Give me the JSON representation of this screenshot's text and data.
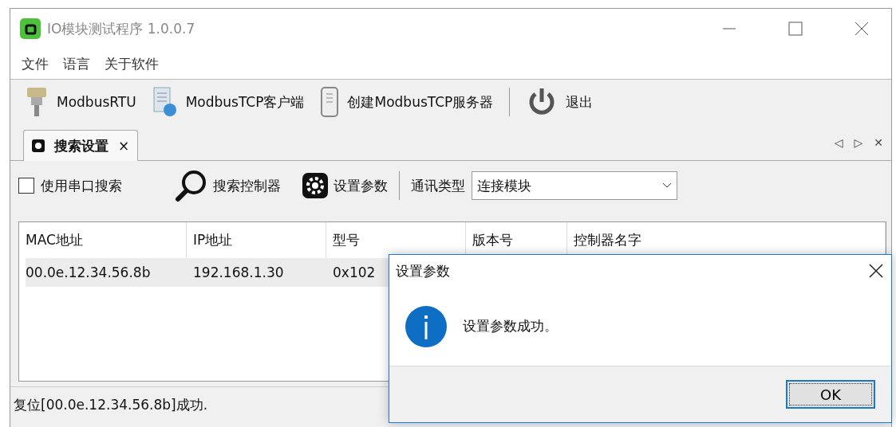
{
  "window": {
    "title": "IO模块测试程序 1.0.0.7"
  },
  "menu": [
    {
      "label": "文件"
    },
    {
      "label": "语言"
    },
    {
      "label": "关于软件"
    }
  ],
  "toolbar": [
    {
      "kind": "connector",
      "label": "ModbusRTU"
    },
    {
      "kind": "client",
      "label": "ModbusTCP客户端"
    },
    {
      "kind": "server",
      "label": "创建ModbusTCP服务器"
    },
    {
      "kind": "power",
      "label": "退出"
    }
  ],
  "tabs": [
    {
      "label": "搜索设置",
      "selected": true,
      "close": "×"
    }
  ],
  "tab_nav": {
    "prev": "◁",
    "next": "▷",
    "close": "✕"
  },
  "search_bar": {
    "checkbox": {
      "label": "使用串口搜索",
      "checked": false
    },
    "buttons": [
      {
        "kind": "search",
        "label": "搜索控制器"
      },
      {
        "kind": "gear",
        "label": "设置参数"
      }
    ],
    "comm_type": {
      "label": "通讯类型",
      "value": "连接模块"
    }
  },
  "table": {
    "columns": [
      "MAC地址",
      "IP地址",
      "型号",
      "版本号",
      "控制器名字"
    ],
    "rows": [
      {
        "cells": [
          "00.0e.12.34.56.8b",
          "192.168.1.30",
          "0x102"
        ],
        "selected": true
      }
    ]
  },
  "status_bar": "复位[00.0e.12.34.56.8b]成功.",
  "dialog": {
    "title": "设置参数",
    "message": "设置参数成功。",
    "button": "OK"
  }
}
